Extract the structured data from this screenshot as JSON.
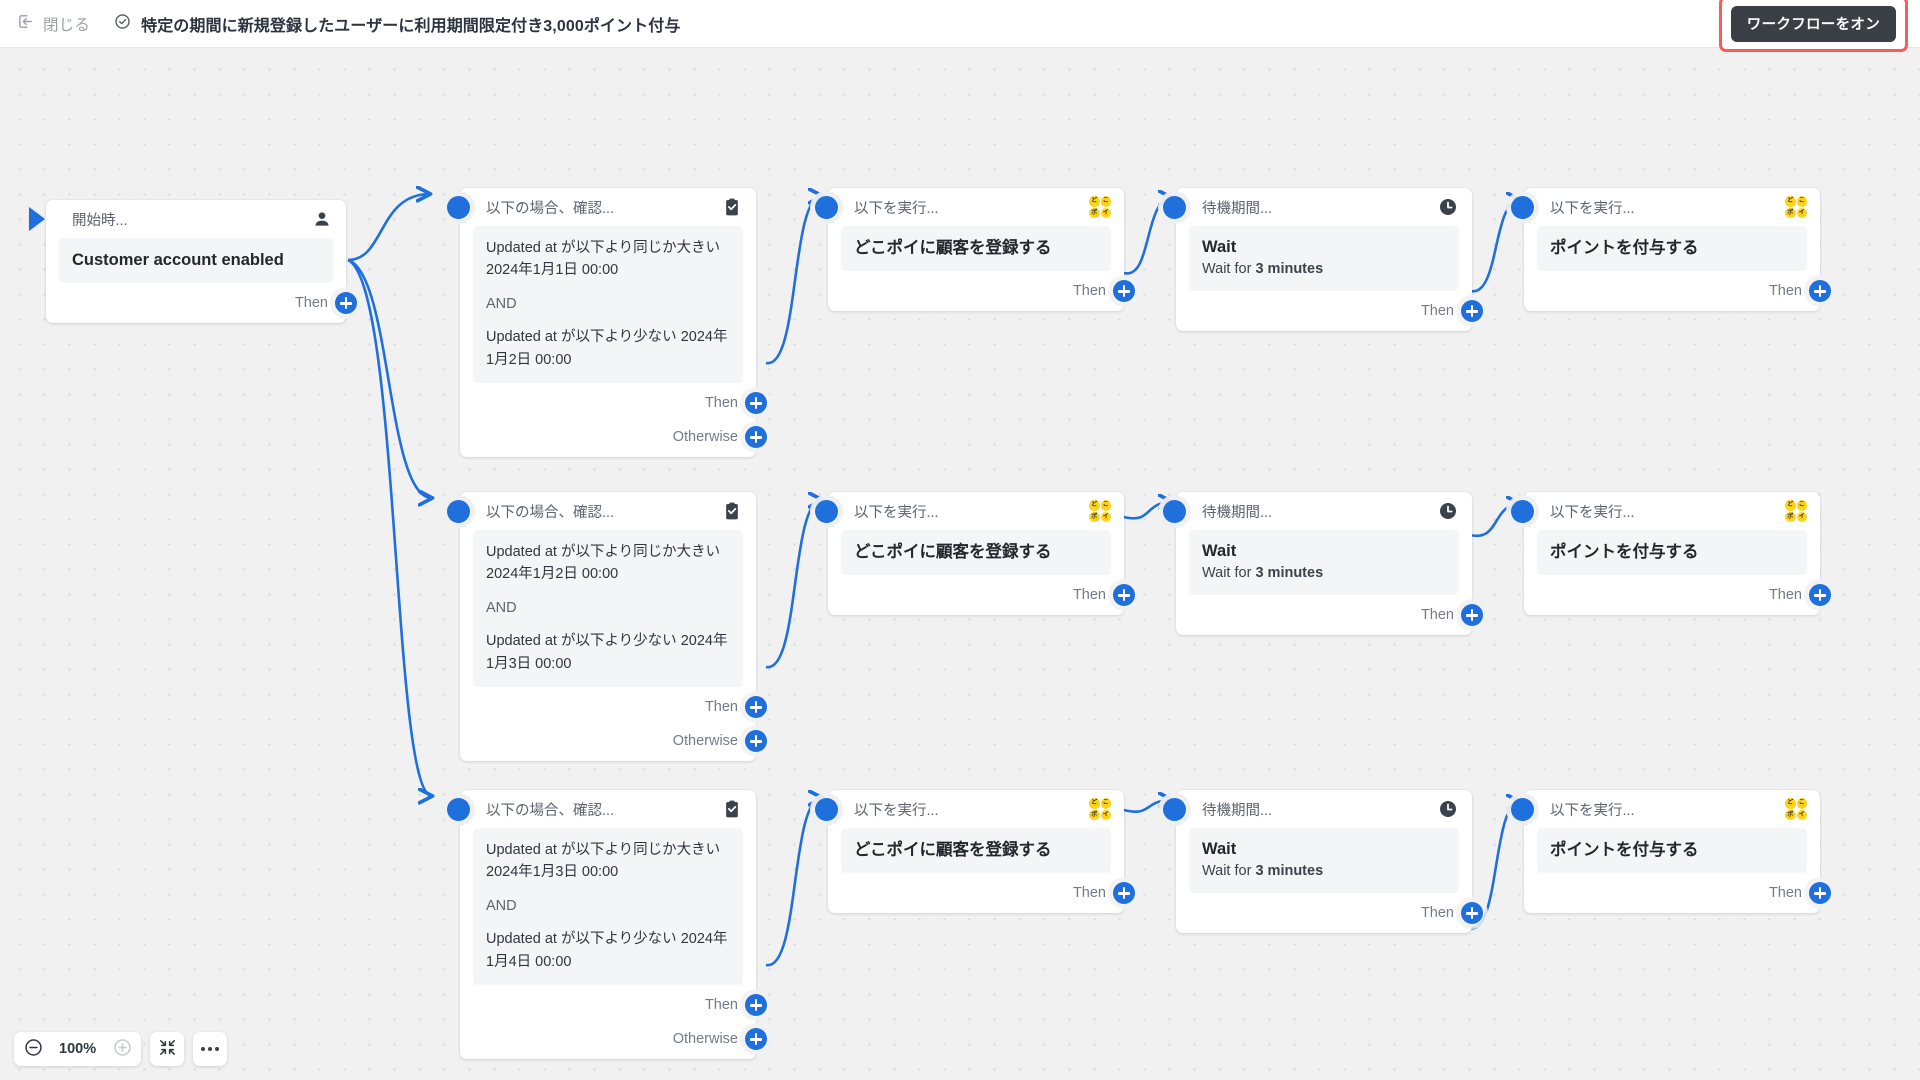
{
  "topbar": {
    "close_label": "閉じる",
    "close_icon": "exit-arrow-icon",
    "status_icon": "check-circle-icon",
    "title": "特定の期間に新規登録したユーザーに利用期間限定付き3,000ポイント付与",
    "toggle_label": "ワークフローをオン",
    "highlight_color": "#fb5b5b",
    "toggle_bg_color": "#3a3f46"
  },
  "canvas": {
    "background_color": "#f1f1f1",
    "accent_color": "#1f6fdd"
  },
  "labels": {
    "then": "Then",
    "otherwise": "Otherwise",
    "and": "AND"
  },
  "nodes": {
    "trigger": {
      "header": "開始時...",
      "icon": "person-icon",
      "main_text": "Customer account enabled",
      "then": "Then"
    },
    "conditions": [
      {
        "header": "以下の場合、確認...",
        "icon": "clipboard-check-icon",
        "line1": "Updated at が以下より同じか大きい 2024年1月1日 00:00",
        "line2": "AND",
        "line3": "Updated at が以下より少ない 2024年1月2日 00:00",
        "then": "Then",
        "otherwise": "Otherwise"
      },
      {
        "header": "以下の場合、確認...",
        "icon": "clipboard-check-icon",
        "line1": "Updated at が以下より同じか大きい 2024年1月2日 00:00",
        "line2": "AND",
        "line3": "Updated at が以下より少ない 2024年1月3日 00:00",
        "then": "Then",
        "otherwise": "Otherwise"
      },
      {
        "header": "以下の場合、確認...",
        "icon": "clipboard-check-icon",
        "line1": "Updated at が以下より同じか大きい 2024年1月3日 00:00",
        "line2": "AND",
        "line3": "Updated at が以下より少ない 2024年1月4日 00:00",
        "then": "Then",
        "otherwise": "Otherwise"
      }
    ],
    "register_actions": [
      {
        "header": "以下を実行...",
        "icon": "dokopoi-logo-icon",
        "main_text": "どこポイに顧客を登録する",
        "then": "Then"
      },
      {
        "header": "以下を実行...",
        "icon": "dokopoi-logo-icon",
        "main_text": "どこポイに顧客を登録する",
        "then": "Then"
      },
      {
        "header": "以下を実行...",
        "icon": "dokopoi-logo-icon",
        "main_text": "どこポイに顧客を登録する",
        "then": "Then"
      }
    ],
    "waits": [
      {
        "header": "待機期間...",
        "icon": "clock-icon",
        "title": "Wait",
        "sub_prefix": "Wait for ",
        "sub_value": "3 minutes",
        "then": "Then"
      },
      {
        "header": "待機期間...",
        "icon": "clock-icon",
        "title": "Wait",
        "sub_prefix": "Wait for ",
        "sub_value": "3 minutes",
        "then": "Then"
      },
      {
        "header": "待機期間...",
        "icon": "clock-icon",
        "title": "Wait",
        "sub_prefix": "Wait for ",
        "sub_value": "3 minutes",
        "then": "Then"
      }
    ],
    "point_actions": [
      {
        "header": "以下を実行...",
        "icon": "dokopoi-logo-icon",
        "main_text": "ポイントを付与する",
        "then": "Then"
      },
      {
        "header": "以下を実行...",
        "icon": "dokopoi-logo-icon",
        "main_text": "ポイントを付与する",
        "then": "Then"
      },
      {
        "header": "以下を実行...",
        "icon": "dokopoi-logo-icon",
        "main_text": "ポイントを付与する",
        "then": "Then"
      }
    ]
  },
  "bottombar": {
    "zoom_out_icon": "minus-circle-icon",
    "zoom_level": "100%",
    "zoom_in_icon": "plus-circle-icon",
    "fit_icon": "fit-screen-icon",
    "more_icon": "more-dots-icon"
  },
  "dokopoi_glyphs": [
    "ど",
    "こ",
    "ポ",
    "イ"
  ]
}
